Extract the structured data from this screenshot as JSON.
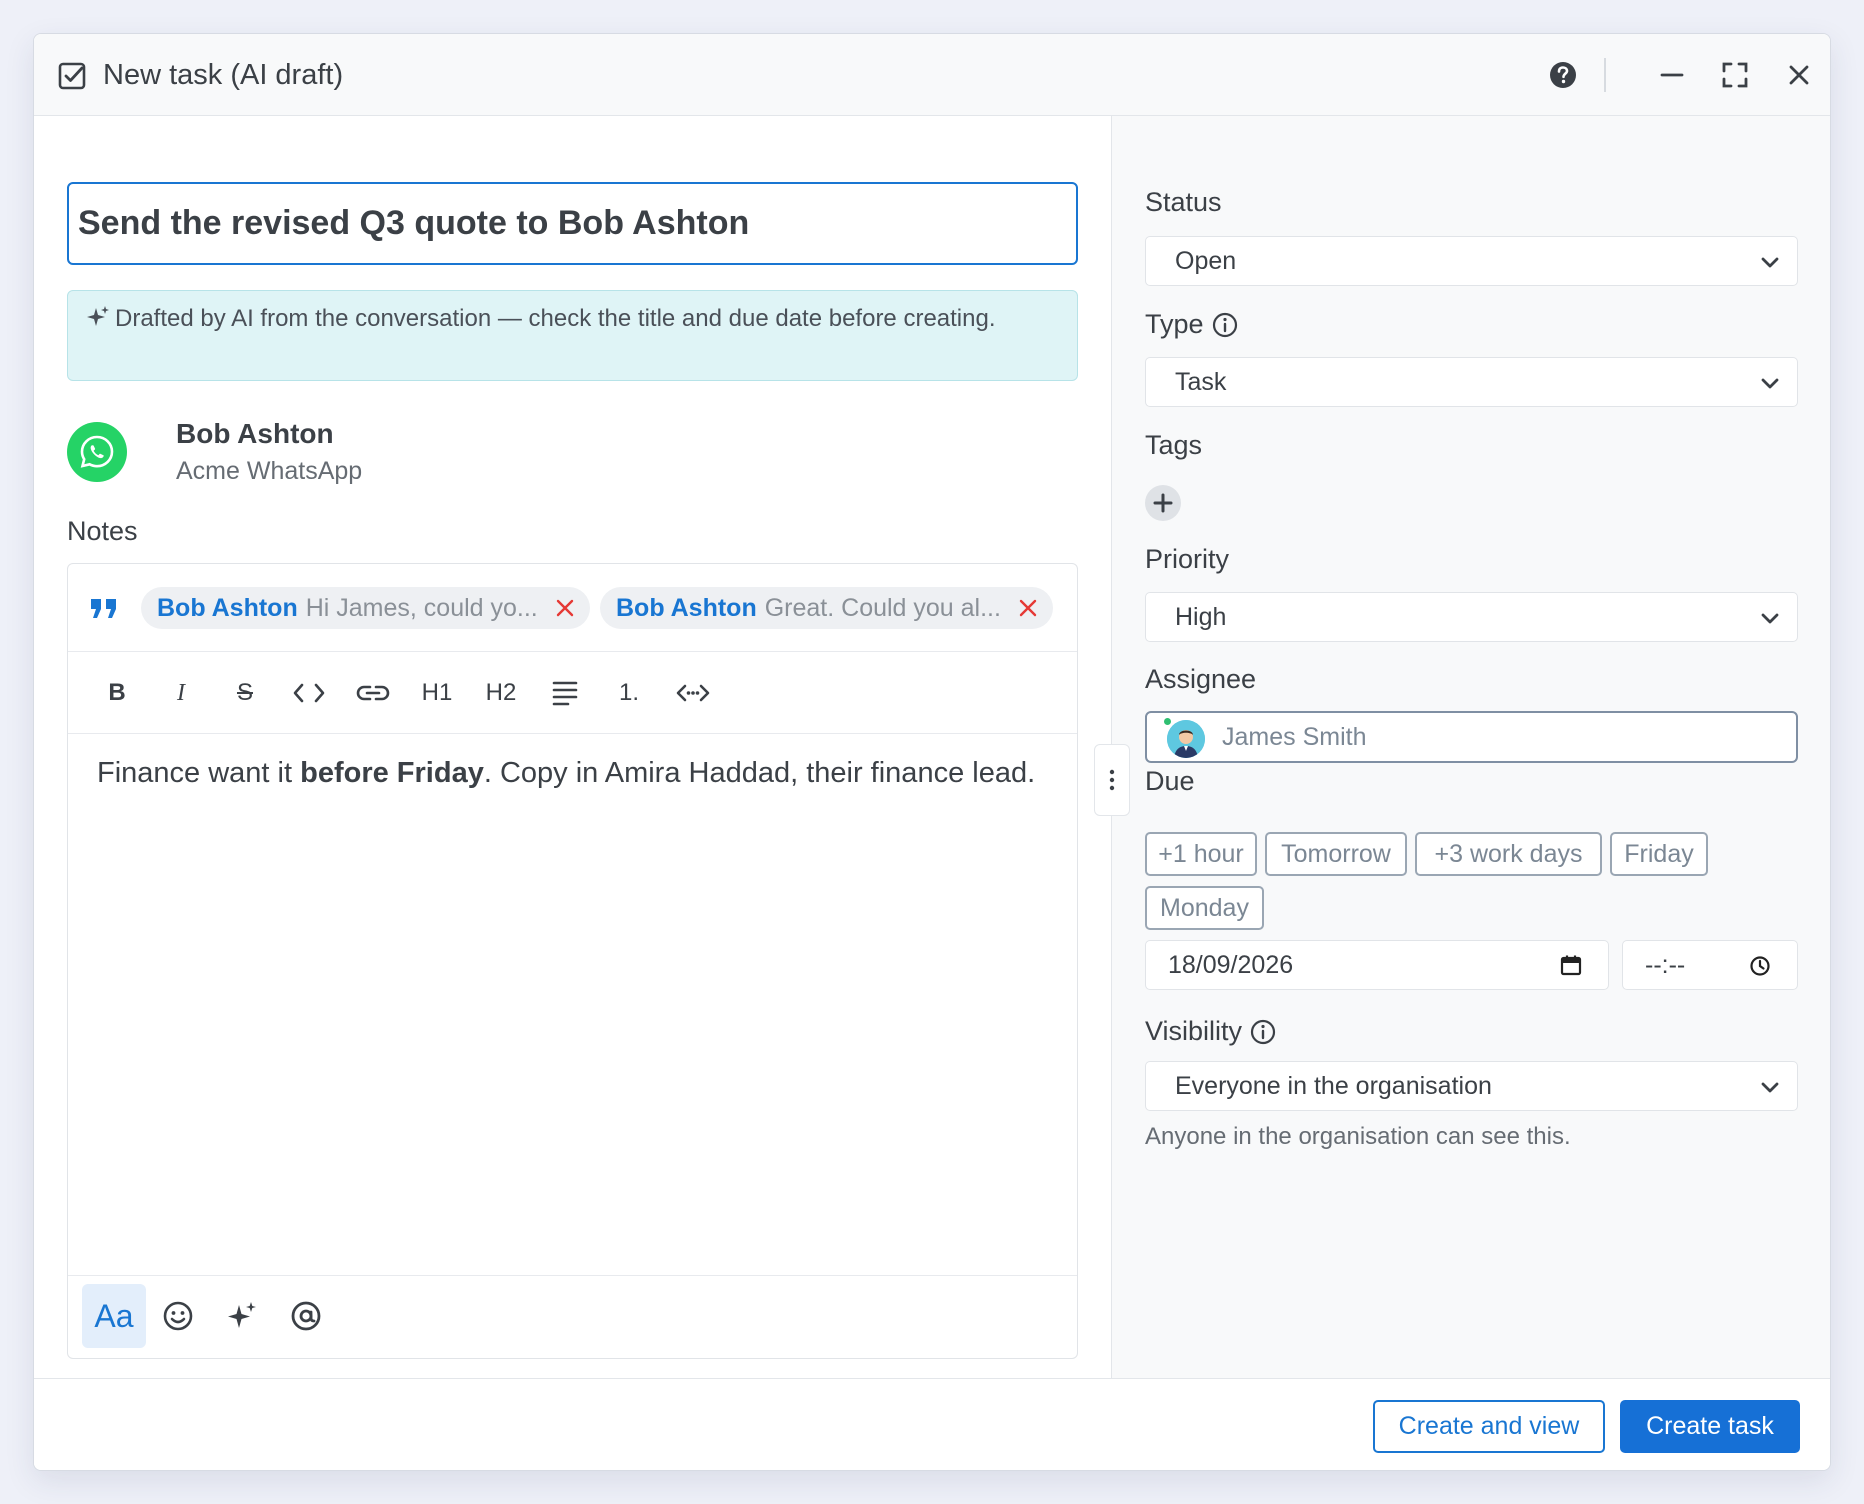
{
  "header": {
    "title": "New task (AI draft)",
    "icons": [
      "checkbox-icon",
      "help-icon",
      "minimize-icon",
      "fullscreen-icon",
      "close-icon"
    ]
  },
  "main": {
    "task_title": "Send the revised Q3 quote to Bob Ashton",
    "ai_banner": "Drafted by AI from the conversation — check the title and due date before creating.",
    "contact": {
      "name": "Bob Ashton",
      "channel": "Acme WhatsApp"
    },
    "notes_label": "Notes",
    "quotes": [
      {
        "who": "Bob Ashton",
        "text": "Hi James, could yo..."
      },
      {
        "who": "Bob Ashton",
        "text": "Great. Could you al..."
      }
    ],
    "toolbar": {
      "bold": "B",
      "italic": "I",
      "strike": "S",
      "code": "<>",
      "link": "link",
      "h1": "H1",
      "h2": "H2",
      "align": "align",
      "ordered": "1.",
      "embed": "<·>"
    },
    "note_text": {
      "before": "Finance want it ",
      "bold": "before Friday",
      "after": ". Copy in Amira Haddad, their finance lead."
    },
    "bottom_bar": {
      "format": "Aa"
    }
  },
  "side": {
    "status": {
      "label": "Status",
      "value": "Open"
    },
    "type": {
      "label": "Type",
      "value": "Task"
    },
    "tags": {
      "label": "Tags"
    },
    "priority": {
      "label": "Priority",
      "value": "High"
    },
    "assignee": {
      "label": "Assignee",
      "value": "James Smith"
    },
    "due": {
      "label": "Due",
      "quick": [
        "+1 hour",
        "Tomorrow",
        "+3 work days",
        "Friday",
        "Monday"
      ],
      "date": "18/09/2026",
      "time": "--:--"
    },
    "visibility": {
      "label": "Visibility",
      "value": "Everyone in the organisation",
      "help": "Anyone in the organisation can see this."
    }
  },
  "footer": {
    "create_and_view": "Create and view",
    "create_task": "Create task"
  },
  "colors": {
    "accent": "#1976d2",
    "ai_banner_bg": "#dff4f6",
    "whatsapp": "#25d366",
    "danger": "#e53935",
    "online": "#2fbf71"
  }
}
